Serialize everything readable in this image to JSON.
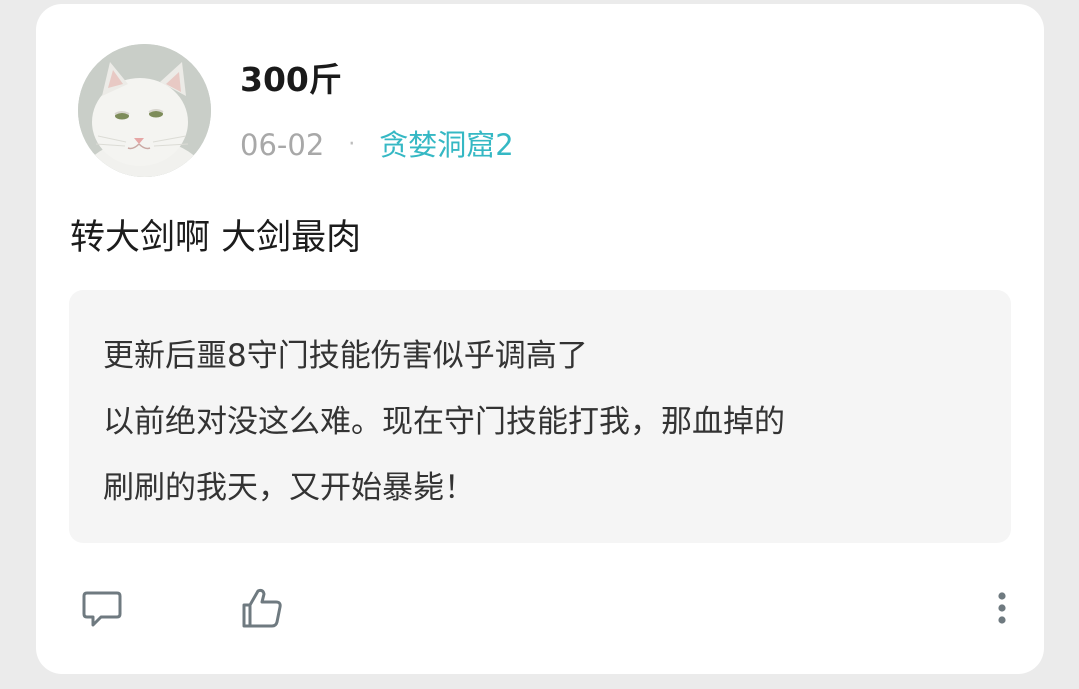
{
  "post": {
    "author": "300斤",
    "date": "06-02",
    "separator": "·",
    "group": "贪婪洞窟2",
    "content": "转大剑啊 大剑最肉"
  },
  "quote": {
    "lines": [
      "更新后噩8守门技能伤害似乎调高了",
      "以前绝对没这么难。现在守门技能打我，那血掉的",
      "刷刷的我天，又开始暴毙！"
    ]
  },
  "actions": {
    "comment_icon": "comment-icon",
    "like_icon": "thumbs-up-icon",
    "more_icon": "more-vertical-icon"
  },
  "colors": {
    "accent": "#35b8c4",
    "background": "#ebebeb",
    "card": "#ffffff",
    "quote_bg": "#f5f5f5"
  }
}
